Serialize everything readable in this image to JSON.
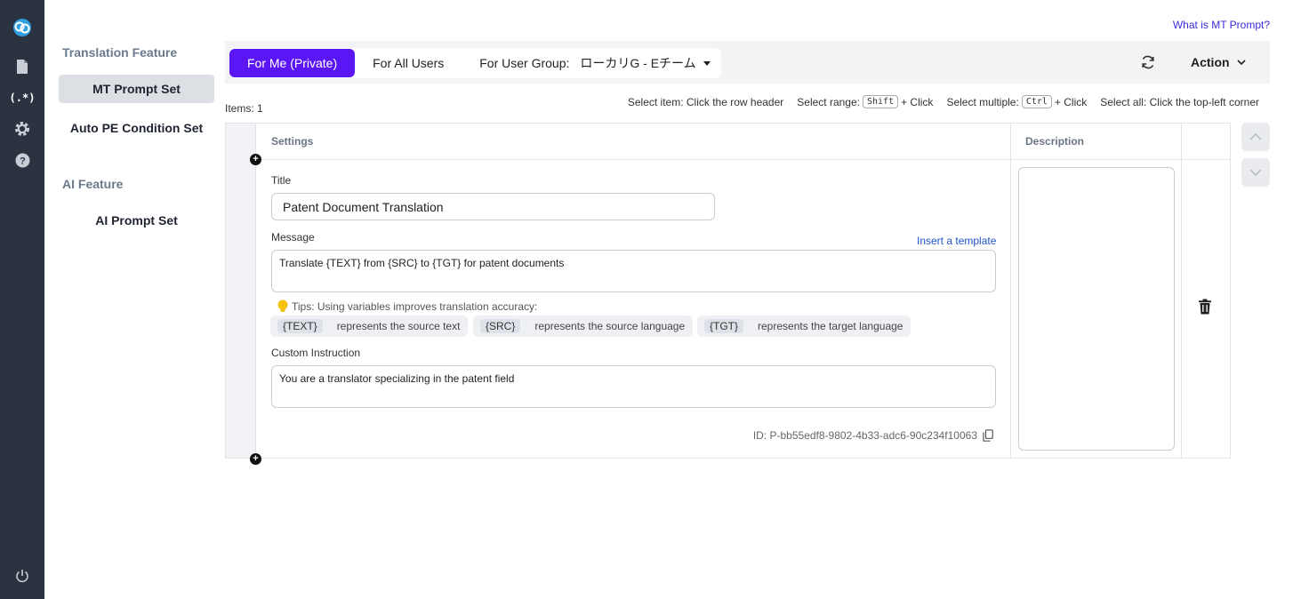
{
  "sidebar": {
    "sections": [
      {
        "title": "Translation Feature",
        "items": [
          "MT Prompt Set",
          "Auto PE Condition Set"
        ]
      },
      {
        "title": "AI Feature",
        "items": [
          "AI Prompt Set"
        ]
      }
    ],
    "active_item": "MT Prompt Set"
  },
  "header": {
    "help_link": "What is MT Prompt?"
  },
  "toolbar": {
    "tabs": [
      "For Me (Private)",
      "For All Users",
      "For User Group:"
    ],
    "user_group_value": "ローカリG - Eチーム",
    "action_label": "Action"
  },
  "list": {
    "items_count": "Items: 1"
  },
  "hints": {
    "select_item": "Select item: Click the row header",
    "select_range_label": "Select range:",
    "select_range_key": "Shift",
    "select_range_suffix": "+ Click",
    "select_multiple_label": "Select multiple:",
    "select_multiple_key": "Ctrl",
    "select_multiple_suffix": "+ Click",
    "select_all": "Select all: Click the top-left corner"
  },
  "table": {
    "columns": [
      "Settings",
      "Description"
    ],
    "row": {
      "title_label": "Title",
      "title_value": "Patent Document Translation",
      "message_label": "Message",
      "insert_template": "Insert a template",
      "message_value": "Translate {TEXT} from {SRC} to {TGT} for patent documents",
      "tips": "Tips: Using variables improves translation accuracy:",
      "variables": [
        {
          "var": "{TEXT}",
          "desc": "represents the source text"
        },
        {
          "var": "{SRC}",
          "desc": "represents the source language"
        },
        {
          "var": "{TGT}",
          "desc": "represents the target language"
        }
      ],
      "custom_label": "Custom Instruction",
      "custom_value": "You are a translator specializing in the patent field",
      "id": "ID: P-bb55edf8-9802-4b33-adc6-90c234f10063",
      "description": ""
    }
  },
  "colors": {
    "accent": "#5a16f5",
    "rail": "#2b3240",
    "link": "#1d54c9"
  }
}
